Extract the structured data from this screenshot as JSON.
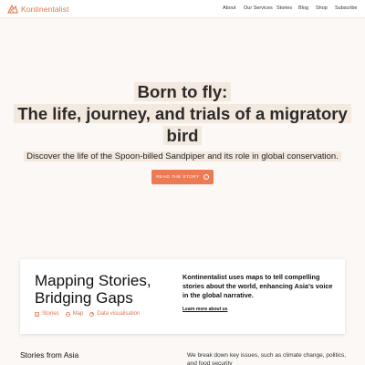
{
  "nav": {
    "logo_text": "Kontinentalist",
    "links": [
      "About",
      "Our Services",
      "Stories",
      "Blog",
      "Shop",
      "Subscribe"
    ]
  },
  "hero": {
    "title_line1": "Born to fly:",
    "title_line2": "The life, journey, and trials of a migratory",
    "title_line3": "bird",
    "subtitle": "Discover the life of the Spoon-billed Sandpiper and its role in global conservation.",
    "cta_label": "READ THE STORY",
    "cta_icon": "arrow-right-circle-icon"
  },
  "card": {
    "title_line1": "Mapping Stories,",
    "title_line2": "Bridging Gaps",
    "tags": [
      {
        "label": "Stories",
        "icon": "book-icon"
      },
      {
        "label": "Map",
        "icon": "globe-icon"
      },
      {
        "label": "Data visualisation",
        "icon": "chart-icon"
      }
    ],
    "description": "Kontinentalist uses maps to tell compelling stories about the world, enhancing Asia's voice in the global narrative.",
    "link_label": "Learn more about us"
  },
  "section": {
    "title": "Stories from Asia",
    "description": "We break down key issues, such as climate change, politics, and food security"
  },
  "colors": {
    "accent": "#ec7a54",
    "highlight": "#f4e9df",
    "background": "#fbf8f5"
  }
}
